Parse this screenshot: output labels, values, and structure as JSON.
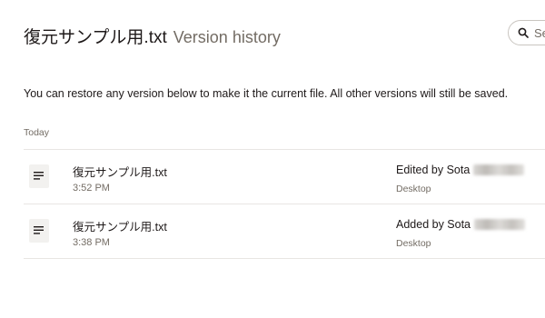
{
  "header": {
    "file_name": "復元サンプル用.txt",
    "subtitle": "Version history"
  },
  "search": {
    "placeholder": "Se"
  },
  "info_text": "You can restore any version below to make it the current file. All other versions will still be saved.",
  "sections": [
    {
      "label": "Today",
      "versions": [
        {
          "file_name": "復元サンプル用.txt",
          "time": "3:52 PM",
          "action": "Edited by Sota",
          "device": "Desktop",
          "icon": "text-file-icon"
        },
        {
          "file_name": "復元サンプル用.txt",
          "time": "3:38 PM",
          "action": "Added by Sota",
          "device": "Desktop",
          "icon": "text-file-icon"
        }
      ]
    }
  ]
}
